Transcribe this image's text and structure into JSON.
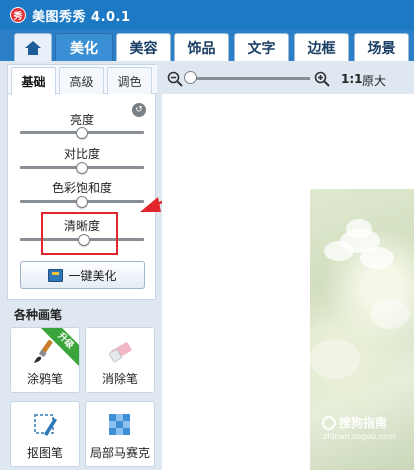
{
  "app": {
    "logo_text": "秀",
    "title": "美图秀秀 4.0.1"
  },
  "tabs": [
    {
      "label": "",
      "icon": "home-icon"
    },
    {
      "label": "美化"
    },
    {
      "label": "美容"
    },
    {
      "label": "饰品"
    },
    {
      "label": "文字"
    },
    {
      "label": "边框"
    },
    {
      "label": "场景"
    }
  ],
  "active_tab": "美化",
  "subtabs": [
    {
      "label": "基础"
    },
    {
      "label": "高级"
    },
    {
      "label": "调色"
    }
  ],
  "adjustments": [
    {
      "label": "亮度",
      "value": 0.5
    },
    {
      "label": "对比度",
      "value": 0.5
    },
    {
      "label": "色彩饱和度",
      "value": 0.5
    },
    {
      "label": "清晰度",
      "value": 0.52
    }
  ],
  "reset_icon": "reset-icon",
  "beautify_button": {
    "label": "一键美化",
    "icon": "magic-wand-icon"
  },
  "brushes": {
    "title": "各种画笔",
    "tools": [
      {
        "label": "涂鸦笔",
        "icon": "paintbrush-icon",
        "badge": "升级"
      },
      {
        "label": "消除笔",
        "icon": "eraser-icon"
      },
      {
        "label": "抠图笔",
        "icon": "pen-cutout-icon"
      },
      {
        "label": "局部马赛克",
        "icon": "mosaic-icon"
      }
    ]
  },
  "zoom": {
    "value": 0.0,
    "ratio_label": "1:1",
    "original_label": "原大"
  },
  "watermark": {
    "text": "搜狗指南",
    "url": "zhinan.sogou.com"
  },
  "colors": {
    "titlebar": "#1d79c4",
    "accent": "#3b8fd4",
    "highlight": "#e0262a"
  }
}
